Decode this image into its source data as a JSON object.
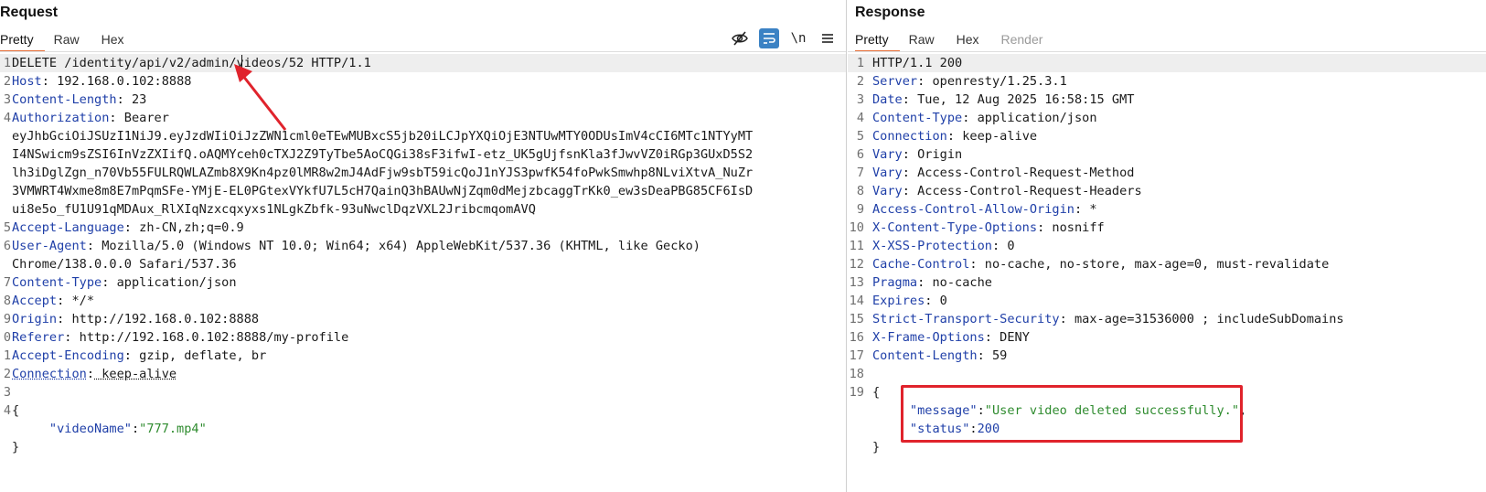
{
  "request": {
    "title": "Request",
    "tabs": [
      "Pretty",
      "Raw",
      "Hex"
    ],
    "active_tab": "Pretty",
    "toolbar_icons": [
      "eye-slash-icon",
      "wrap-icon",
      "newline-icon",
      "menu-icon"
    ],
    "newline_label": "\\n",
    "lines": [
      {
        "n": "1",
        "text": "DELETE /identity/api/v2/admin/videos/52 HTTP/1.1"
      },
      {
        "n": "2",
        "name": "Host",
        "value": " 192.168.0.102:8888"
      },
      {
        "n": "3",
        "name": "Content-Length",
        "value": " 23"
      },
      {
        "n": "4",
        "name": "Authorization",
        "value": " Bearer"
      },
      {
        "n": "",
        "text": "eyJhbGciOiJSUzI1NiJ9.eyJzdWIiOiJzZWN1cml0eTEwMUBxcS5jb20iLCJpYXQiOjE3NTUwMTY0ODUsImV4cCI6MTc1NTYyMT"
      },
      {
        "n": "",
        "text": "I4NSwicm9sZSI6InVzZXIifQ.oAQMYceh0cTXJ2Z9TyTbe5AoCQGi38sF3ifwI-etz_UK5gUjfsnKla3fJwvVZ0iRGp3GUxD5S2"
      },
      {
        "n": "",
        "text": "lh3iDglZgn_n70Vb55FULRQWLAZmb8X9Kn4pz0lMR8w2mJ4AdFjw9sbT59icQoJ1nYJS3pwfK54foPwkSmwhp8NLviXtvA_NuZr"
      },
      {
        "n": "",
        "text": "3VMWRT4Wxme8m8E7mPqmSFe-YMjE-EL0PGtexVYkfU7L5cH7QainQ3hBAUwNjZqm0dMejzbcaggTrKk0_ew3sDeaPBG85CF6IsD"
      },
      {
        "n": "",
        "text": "ui8e5o_fU1U91qMDAux_RlXIqNzxcqxyxs1NLgkZbfk-93uNwclDqzVXL2JribcmqomAVQ"
      },
      {
        "n": "5",
        "name": "Accept-Language",
        "value": " zh-CN,zh;q=0.9"
      },
      {
        "n": "6",
        "name": "User-Agent",
        "value": " Mozilla/5.0 (Windows NT 10.0; Win64; x64) AppleWebKit/537.36 (KHTML, like Gecko)"
      },
      {
        "n": "",
        "text": "Chrome/138.0.0.0 Safari/537.36"
      },
      {
        "n": "7",
        "name": "Content-Type",
        "value": " application/json"
      },
      {
        "n": "8",
        "name": "Accept",
        "value": " */*"
      },
      {
        "n": "9",
        "name": "Origin",
        "value": " http://192.168.0.102:8888"
      },
      {
        "n": "0",
        "name": "Referer",
        "value": " http://192.168.0.102:8888/my-profile"
      },
      {
        "n": "1",
        "name": "Accept-Encoding",
        "value": " gzip, deflate, br"
      },
      {
        "n": "2",
        "name": "Connection",
        "value": " keep-alive"
      },
      {
        "n": "3",
        "text": ""
      },
      {
        "n": "4",
        "text": "{"
      },
      {
        "n": "",
        "json_key": "\"videoName\"",
        "json_sep": ":",
        "json_str": "\"777.mp4\"",
        "indent": "     "
      },
      {
        "n": "",
        "text": "}"
      }
    ]
  },
  "response": {
    "title": "Response",
    "tabs": [
      "Pretty",
      "Raw",
      "Hex",
      "Render"
    ],
    "active_tab": "Pretty",
    "lines": [
      {
        "n": "1",
        "text": "HTTP/1.1 200"
      },
      {
        "n": "2",
        "name": "Server",
        "value": " openresty/1.25.3.1"
      },
      {
        "n": "3",
        "name": "Date",
        "value": " Tue, 12 Aug 2025 16:58:15 GMT"
      },
      {
        "n": "4",
        "name": "Content-Type",
        "value": " application/json"
      },
      {
        "n": "5",
        "name": "Connection",
        "value": " keep-alive"
      },
      {
        "n": "6",
        "name": "Vary",
        "value": " Origin"
      },
      {
        "n": "7",
        "name": "Vary",
        "value": " Access-Control-Request-Method"
      },
      {
        "n": "8",
        "name": "Vary",
        "value": " Access-Control-Request-Headers"
      },
      {
        "n": "9",
        "name": "Access-Control-Allow-Origin",
        "value": " *"
      },
      {
        "n": "10",
        "name": "X-Content-Type-Options",
        "value": " nosniff"
      },
      {
        "n": "11",
        "name": "X-XSS-Protection",
        "value": " 0"
      },
      {
        "n": "12",
        "name": "Cache-Control",
        "value": " no-cache, no-store, max-age=0, must-revalidate"
      },
      {
        "n": "13",
        "name": "Pragma",
        "value": " no-cache"
      },
      {
        "n": "14",
        "name": "Expires",
        "value": " 0"
      },
      {
        "n": "15",
        "name": "Strict-Transport-Security",
        "value": " max-age=31536000 ; includeSubDomains"
      },
      {
        "n": "16",
        "name": "X-Frame-Options",
        "value": " DENY"
      },
      {
        "n": "17",
        "name": "Content-Length",
        "value": " 59"
      },
      {
        "n": "18",
        "text": ""
      },
      {
        "n": "19",
        "text": "{"
      },
      {
        "n": "",
        "json_key": "\"message\"",
        "json_sep": ":",
        "json_str": "\"User video deleted successfully.\"",
        "json_tail": ",",
        "indent": "     "
      },
      {
        "n": "",
        "json_key": "\"status\"",
        "json_sep": ":",
        "json_num": "200",
        "indent": "     "
      },
      {
        "n": "",
        "text": "}"
      }
    ]
  },
  "colors": {
    "accent_tab": "#e8703a",
    "header_name": "#1f3fa8",
    "json_string": "#2e8b2e",
    "annotation_red": "#e0232c",
    "toolbar_active": "#3b82c4"
  }
}
